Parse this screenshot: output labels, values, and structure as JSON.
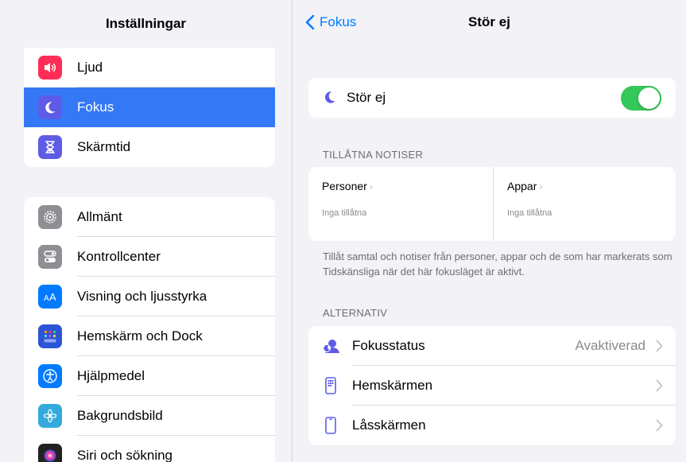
{
  "sidebar": {
    "title": "Inställningar",
    "top_group": [
      {
        "label": "Ljud",
        "icon": "speaker-icon",
        "color": "#ff2d55"
      },
      {
        "label": "Fokus",
        "icon": "moon-icon",
        "color": "#5e5ce6"
      },
      {
        "label": "Skärmtid",
        "icon": "hourglass-icon",
        "color": "#5e5ce6"
      }
    ],
    "general_group": [
      {
        "label": "Allmänt",
        "icon": "gear-icon",
        "color": "#8e8e93"
      },
      {
        "label": "Kontrollcenter",
        "icon": "toggles-icon",
        "color": "#8e8e93"
      },
      {
        "label": "Visning och ljusstyrka",
        "icon": "text-size-icon",
        "color": "#007aff"
      },
      {
        "label": "Hemskärm och Dock",
        "icon": "home-grid-icon",
        "color": "#2c54d6"
      },
      {
        "label": "Hjälpmedel",
        "icon": "accessibility-icon",
        "color": "#007aff"
      },
      {
        "label": "Bakgrundsbild",
        "icon": "flower-icon",
        "color": "#34aadc"
      },
      {
        "label": "Siri och sökning",
        "icon": "siri-icon",
        "color": "#222222"
      }
    ],
    "selected": "Fokus"
  },
  "nav": {
    "back_label": "Fokus",
    "title": "Stör ej"
  },
  "focus_toggle": {
    "label": "Stör ej",
    "on": true
  },
  "allowed": {
    "header": "TILLÅTNA NOTISER",
    "people_title": "Personer",
    "people_sub": "Inga tillåtna",
    "apps_title": "Appar",
    "apps_sub": "Inga tillåtna",
    "footer": "Tillåt samtal och notiser från personer, appar och de som har markerats som Tidskänsliga när det här fokusläget är aktivt."
  },
  "options": {
    "header": "ALTERNATIV",
    "rows": [
      {
        "label": "Fokusstatus",
        "value": "Avaktiverad",
        "icon": "focus-status-icon"
      },
      {
        "label": "Hemskärmen",
        "value": "",
        "icon": "home-screen-icon"
      },
      {
        "label": "Låsskärmen",
        "value": "",
        "icon": "lock-screen-icon"
      }
    ]
  },
  "colors": {
    "accent": "#007aff",
    "selected_row": "#3478f6",
    "switch_on": "#34c759",
    "focus_purple": "#5e5ce6"
  }
}
